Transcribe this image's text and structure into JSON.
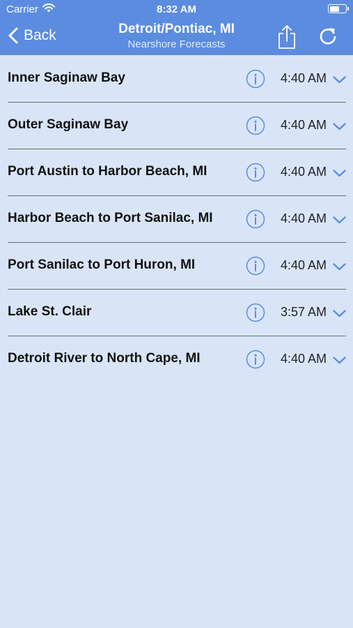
{
  "status_bar": {
    "carrier": "Carrier",
    "time": "8:32 AM",
    "battery_level": 0.62
  },
  "nav": {
    "back_label": "Back",
    "title": "Detroit/Pontiac, MI",
    "subtitle": "Nearshore Forecasts",
    "share_icon": "share-icon",
    "refresh_icon": "refresh-icon"
  },
  "colors": {
    "header": "#5b8cdf",
    "background": "#d9e5f7",
    "accent": "#5b8cdf",
    "divider": "#6b6b6b"
  },
  "forecasts": [
    {
      "name": "Inner Saginaw Bay",
      "time": "4:40 AM"
    },
    {
      "name": "Outer Saginaw Bay",
      "time": "4:40 AM"
    },
    {
      "name": "Port Austin to Harbor Beach, MI",
      "time": "4:40 AM"
    },
    {
      "name": "Harbor Beach to Port Sanilac, MI",
      "time": "4:40 AM"
    },
    {
      "name": "Port Sanilac to Port Huron, MI",
      "time": "4:40 AM"
    },
    {
      "name": "Lake St. Clair",
      "time": "3:57 AM"
    },
    {
      "name": "Detroit River to North Cape, MI",
      "time": "4:40 AM"
    }
  ]
}
